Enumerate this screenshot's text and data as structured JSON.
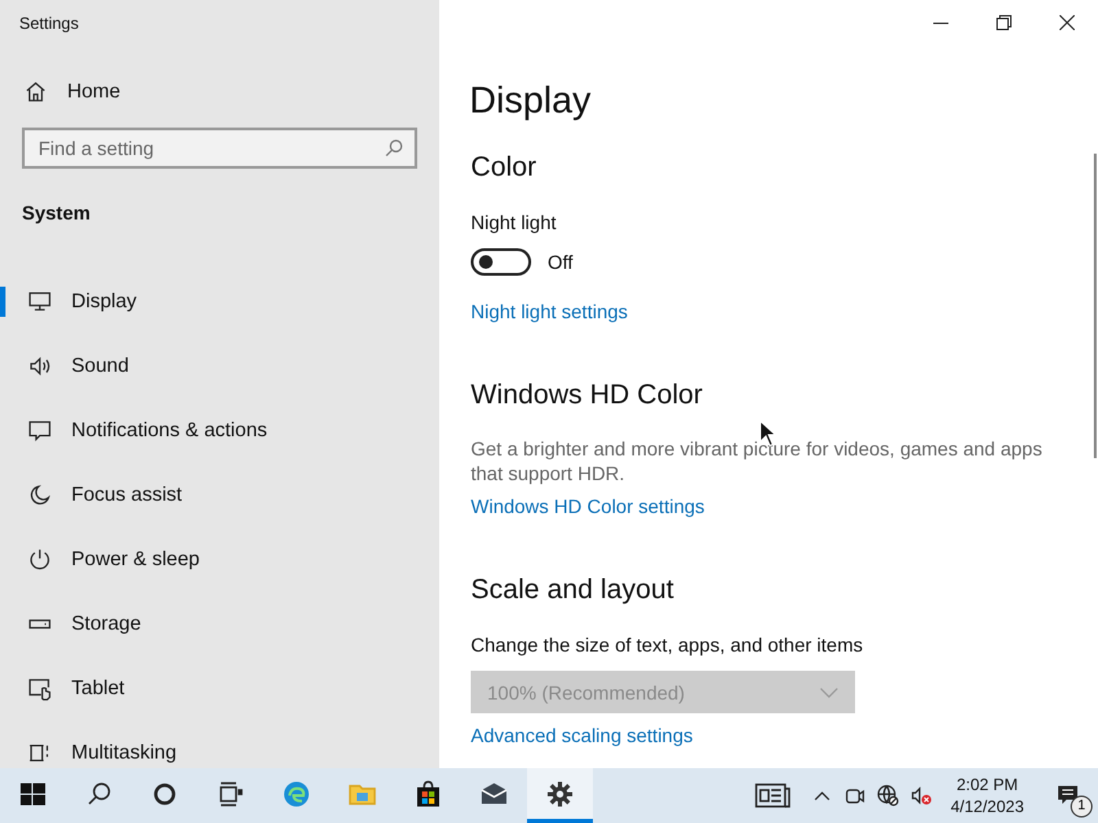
{
  "window": {
    "title": "Settings"
  },
  "sidebar": {
    "home": "Home",
    "search": {
      "placeholder": "Find a setting"
    },
    "section": "System",
    "items": [
      {
        "label": "Display",
        "selected": true
      },
      {
        "label": "Sound",
        "selected": false
      },
      {
        "label": "Notifications & actions",
        "selected": false
      },
      {
        "label": "Focus assist",
        "selected": false
      },
      {
        "label": "Power & sleep",
        "selected": false
      },
      {
        "label": "Storage",
        "selected": false
      },
      {
        "label": "Tablet",
        "selected": false
      },
      {
        "label": "Multitasking",
        "selected": false
      }
    ]
  },
  "main": {
    "title": "Display",
    "sections": [
      {
        "heading": "Color",
        "items": [
          {
            "kind": "label",
            "text": "Night light"
          },
          {
            "kind": "toggle",
            "on": false,
            "text": "Off"
          },
          {
            "kind": "link",
            "text": "Night light settings"
          }
        ]
      },
      {
        "heading": "Windows HD Color",
        "items": [
          {
            "kind": "description",
            "text": "Get a brighter and more vibrant picture for videos, games and apps that support HDR."
          },
          {
            "kind": "link",
            "text": "Windows HD Color settings"
          }
        ]
      },
      {
        "heading": "Scale and layout",
        "items": [
          {
            "kind": "label",
            "text": "Change the size of text, apps, and other items"
          },
          {
            "kind": "dropdown",
            "disabled": true,
            "text": "100% (Recommended)"
          },
          {
            "kind": "link",
            "text": "Advanced scaling settings"
          }
        ]
      }
    ]
  },
  "taskbar": {
    "apps": [
      {
        "kind": "start",
        "selected": false
      },
      {
        "kind": "search",
        "selected": false
      },
      {
        "kind": "cortana",
        "selected": false
      },
      {
        "kind": "taskview",
        "selected": false
      },
      {
        "kind": "edge",
        "selected": false
      },
      {
        "kind": "explorer",
        "selected": false
      },
      {
        "kind": "store",
        "selected": false
      },
      {
        "kind": "mail",
        "selected": false
      },
      {
        "kind": "settings",
        "selected": true
      }
    ],
    "time": "2:02 PM",
    "date": "4/12/2023",
    "notification_count": "1"
  }
}
